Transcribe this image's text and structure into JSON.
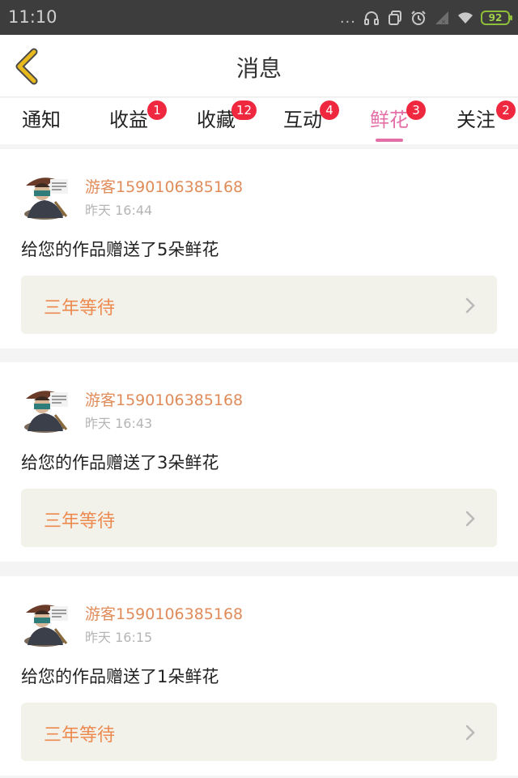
{
  "status_bar": {
    "time": "11:10",
    "dots": "...",
    "battery": "92",
    "icons": [
      "headset-icon",
      "copy-icon",
      "alarm-icon",
      "signal-icon",
      "wifi-icon",
      "battery-icon"
    ]
  },
  "navbar": {
    "title": "消息",
    "back_icon": "chevron-left-icon"
  },
  "tabs": [
    {
      "label": "通知",
      "badge": ""
    },
    {
      "label": "收益",
      "badge": "1"
    },
    {
      "label": "收藏",
      "badge": "12"
    },
    {
      "label": "互动",
      "badge": "4"
    },
    {
      "label": "鲜花",
      "badge": "3"
    },
    {
      "label": "关注",
      "badge": "2"
    }
  ],
  "active_tab": "鲜花",
  "messages": [
    {
      "user": "游客1590106385168",
      "time": "昨天 16:44",
      "text": "给您的作品赠送了5朵鲜花",
      "work": "三年等待"
    },
    {
      "user": "游客1590106385168",
      "time": "昨天 16:43",
      "text": "给您的作品赠送了3朵鲜花",
      "work": "三年等待"
    },
    {
      "user": "游客1590106385168",
      "time": "昨天 16:15",
      "text": "给您的作品赠送了1朵鲜花",
      "work": "三年等待"
    }
  ],
  "colors": {
    "accent": "#e46fa7",
    "username": "#e08c5a",
    "work_title": "#ec8a4f",
    "badge": "#f0283f",
    "back_arrow": "#e8b81f"
  }
}
